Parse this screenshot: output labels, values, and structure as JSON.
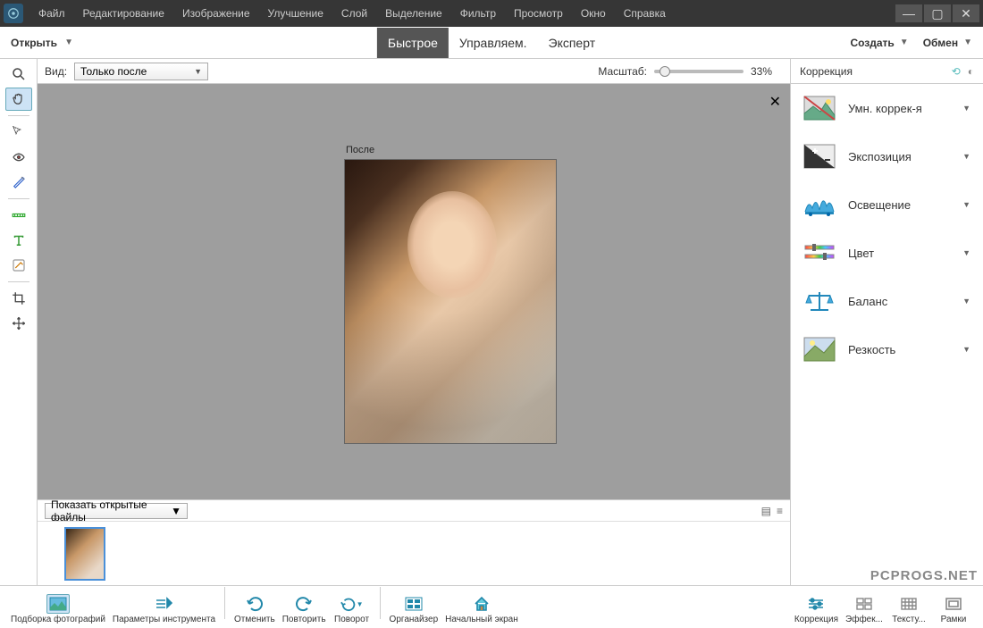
{
  "menubar": [
    "Файл",
    "Редактирование",
    "Изображение",
    "Улучшение",
    "Слой",
    "Выделение",
    "Фильтр",
    "Просмотр",
    "Окно",
    "Справка"
  ],
  "secondbar": {
    "open": "Открыть",
    "create": "Создать",
    "share": "Обмен"
  },
  "modes": {
    "quick": "Быстрое",
    "guided": "Управляем.",
    "expert": "Эксперт"
  },
  "options": {
    "view_label": "Вид:",
    "view_value": "Только после",
    "zoom_label": "Масштаб:",
    "zoom_pct": "33%"
  },
  "canvas": {
    "after_label": "После"
  },
  "photobin": {
    "select": "Показать открытые файлы"
  },
  "panel": {
    "title": "Коррекция",
    "items": [
      "Умн. коррек-я",
      "Экспозиция",
      "Освещение",
      "Цвет",
      "Баланс",
      "Резкость"
    ]
  },
  "bottom": {
    "left": [
      "Подборка фотографий",
      "Параметры инструмента",
      "Отменить",
      "Повторить",
      "Поворот",
      "Органайзер",
      "Начальный экран"
    ],
    "right": [
      "Коррекция",
      "Эффек...",
      "Тексту...",
      "Рамки"
    ]
  },
  "watermark": "PCPROGS.NET"
}
